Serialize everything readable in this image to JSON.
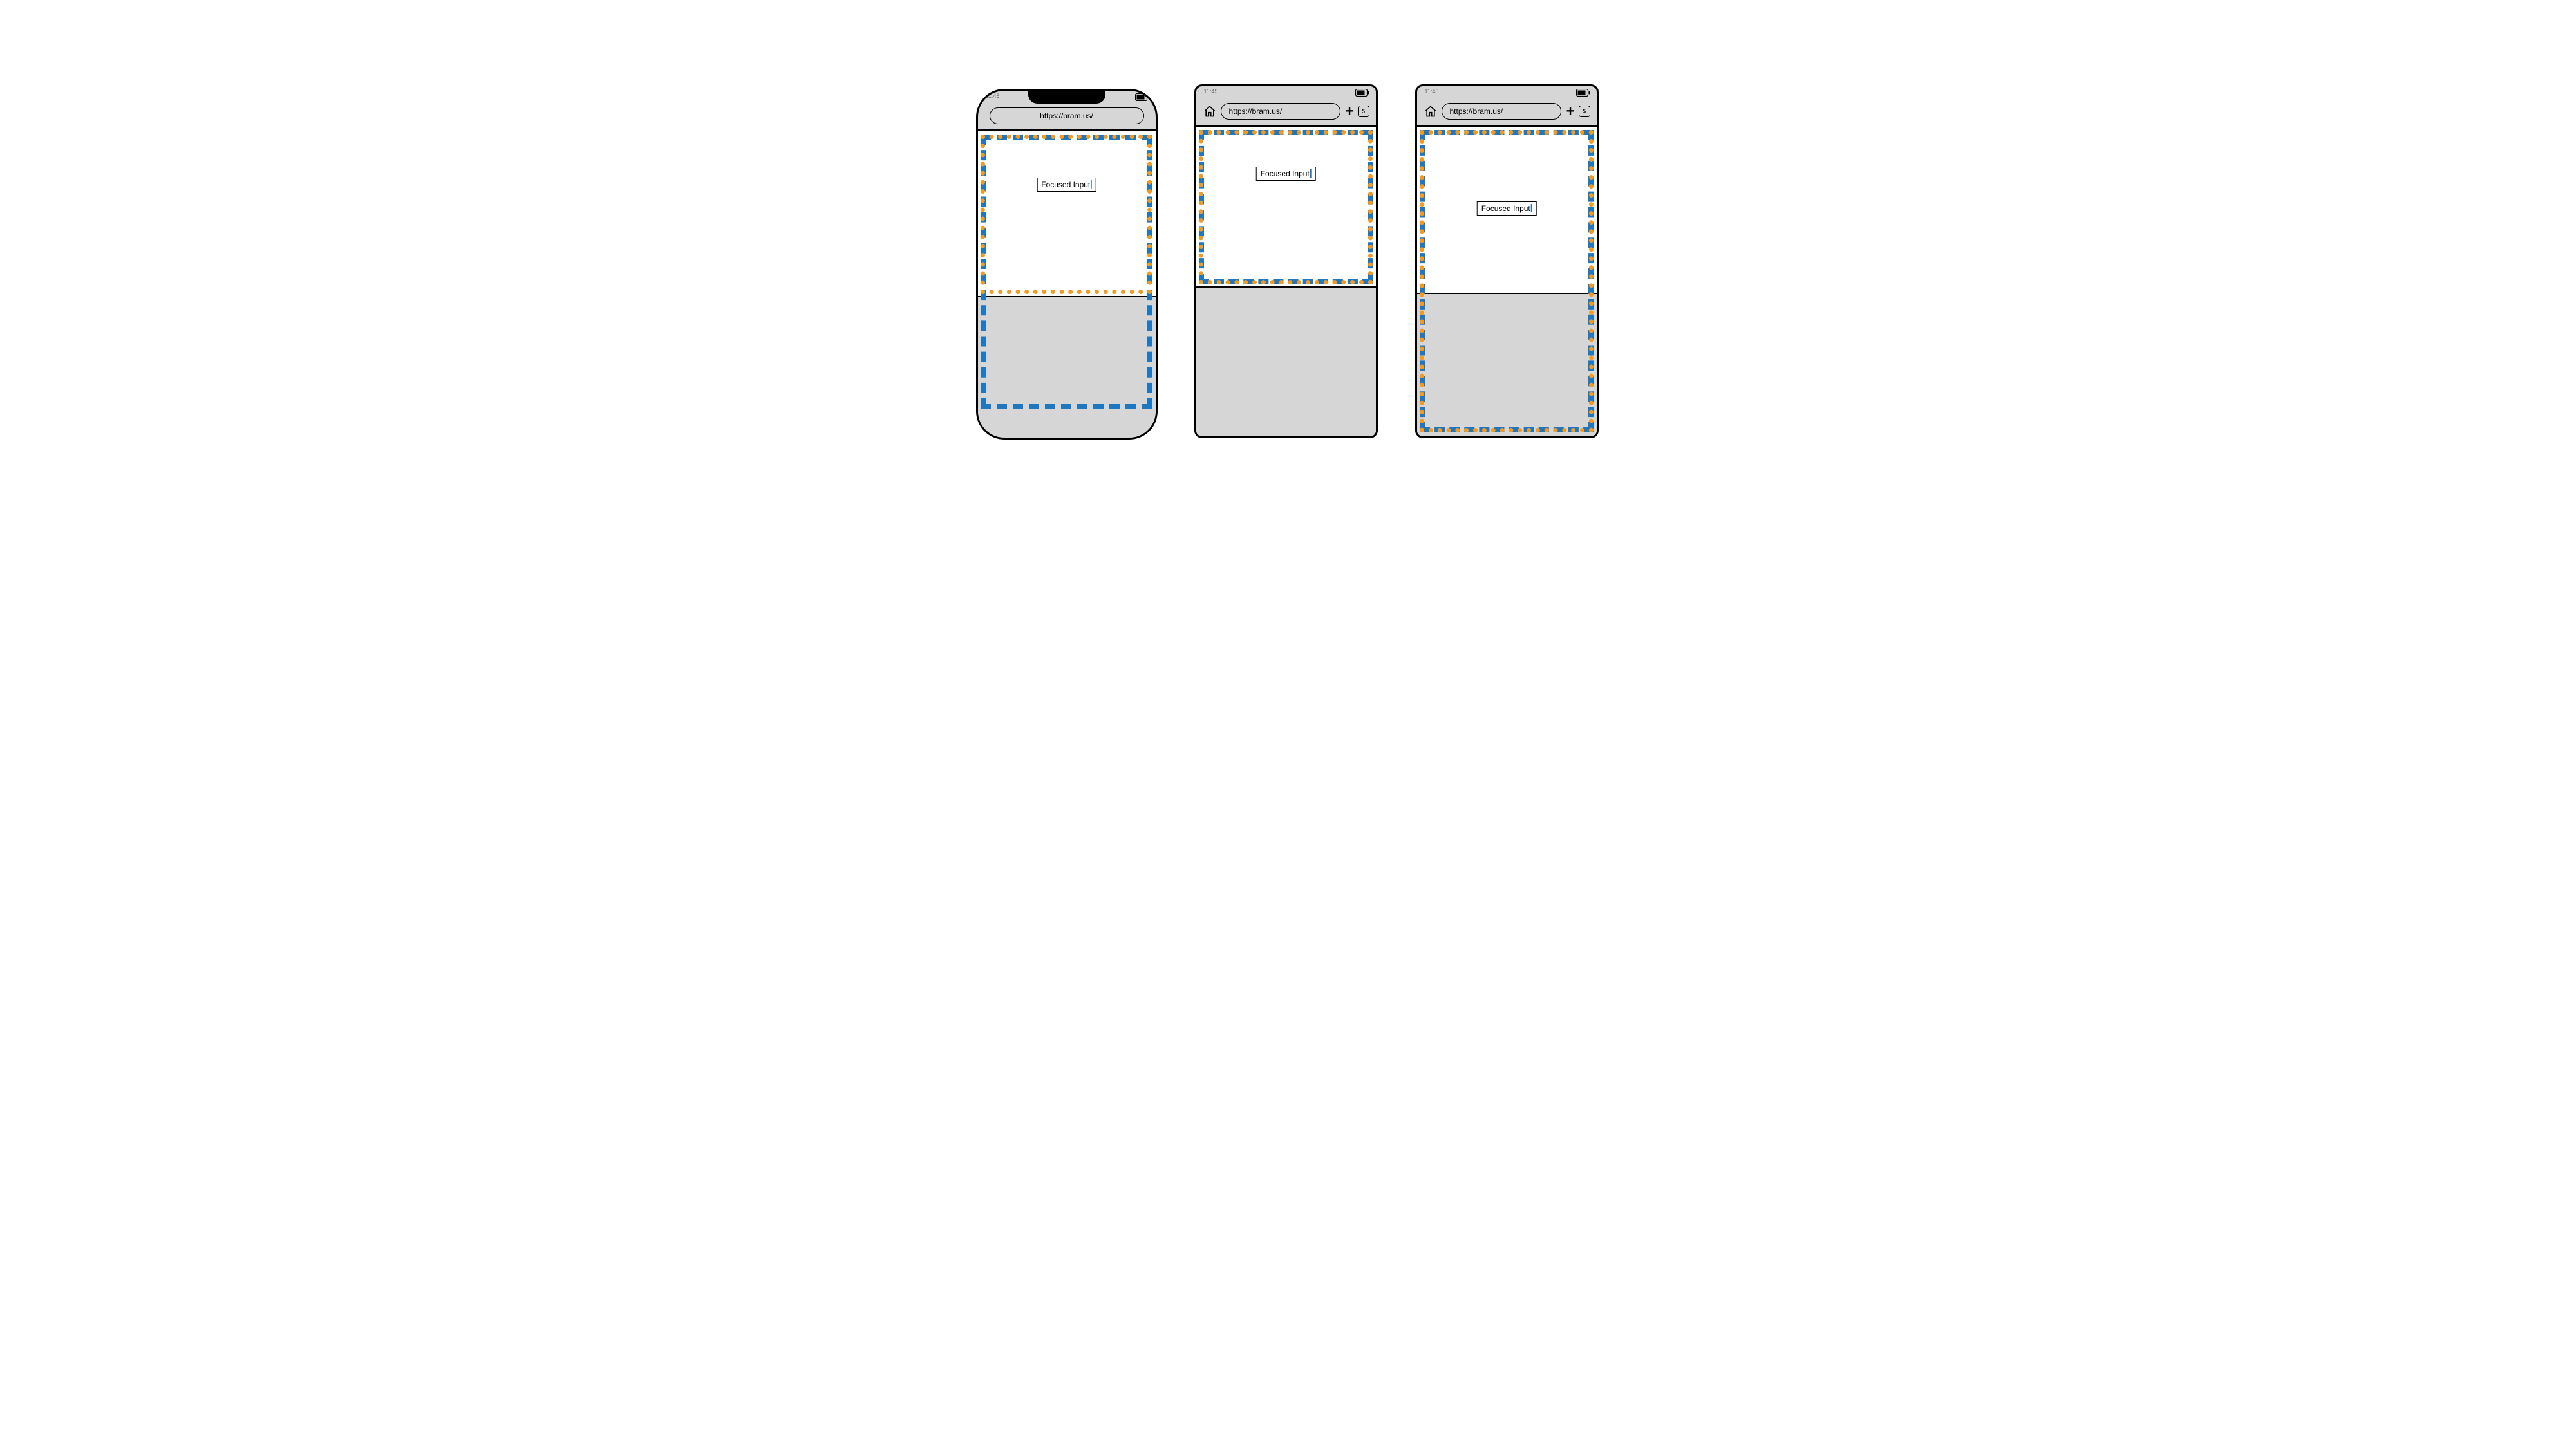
{
  "phones": {
    "status_time": "11:45",
    "url": "https://bram.us/",
    "input_label": "Focused Input",
    "tab_count": "5"
  }
}
